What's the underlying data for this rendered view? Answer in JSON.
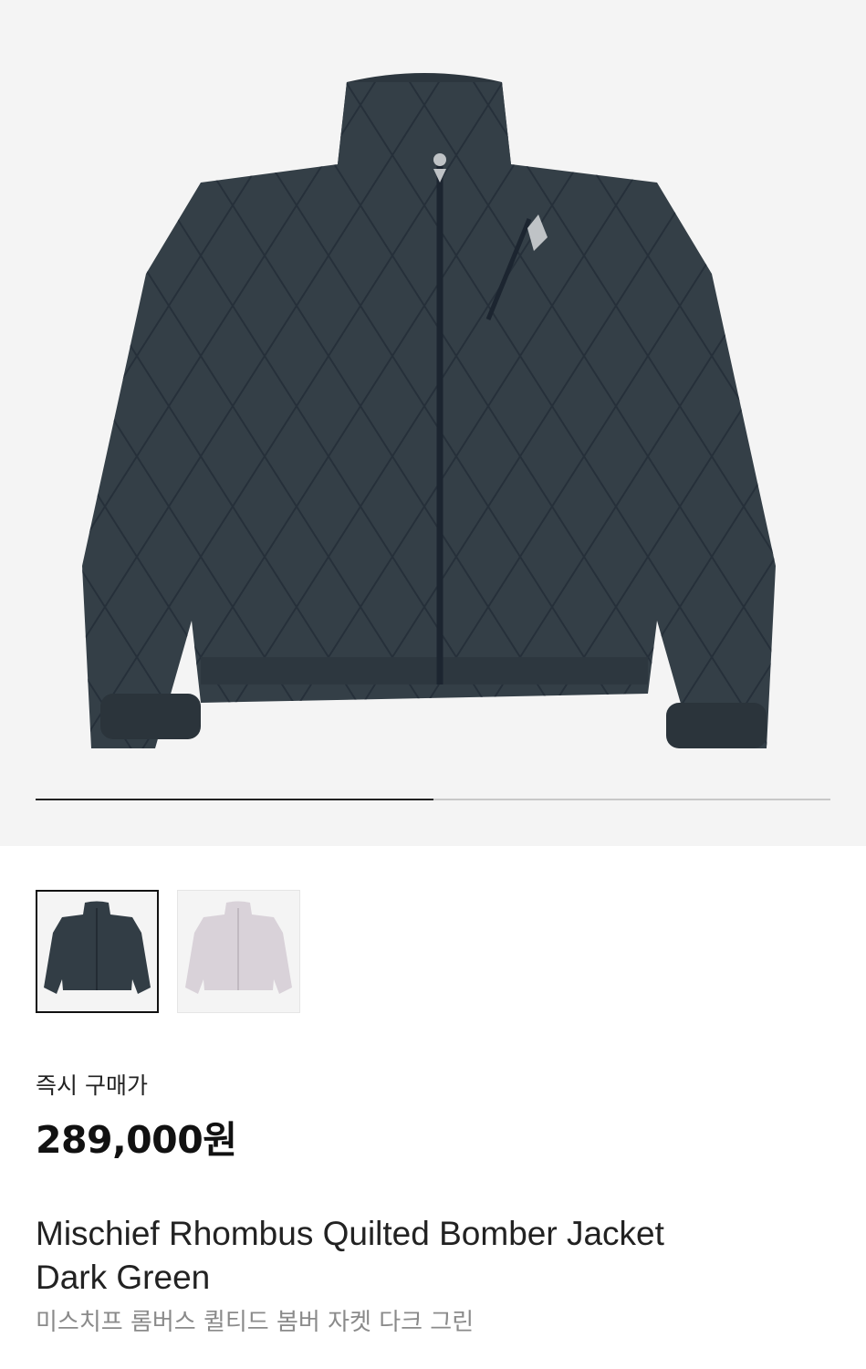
{
  "product_images": {
    "main_alt": "Mischief Rhombus Quilted Bomber Jacket Dark Green",
    "carousel_progress": 0.5,
    "colors": {
      "dark": "#323d45",
      "light": "#d9d2d9",
      "background": "#f4f4f4"
    }
  },
  "thumbnails": [
    {
      "color_name": "dark",
      "selected": true
    },
    {
      "color_name": "light",
      "selected": false
    }
  ],
  "price_section": {
    "label": "즉시 구매가",
    "price": "289,000원"
  },
  "product": {
    "name_line1": "Mischief Rhombus Quilted Bomber Jacket",
    "name_line2": "Dark Green",
    "name_korean": "미스치프 롬버스 퀼티드 봄버 자켓 다크 그린"
  }
}
